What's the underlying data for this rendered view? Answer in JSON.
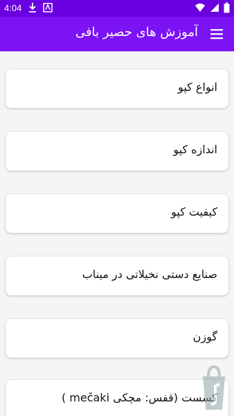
{
  "status_bar": {
    "time": "4:04",
    "left_icons": [
      "download-icon",
      "notification-icon"
    ],
    "right_icons": [
      "wifi-icon",
      "signal-icon",
      "battery-icon"
    ],
    "color": "#6a00e0"
  },
  "app_bar": {
    "title": "آموزش های حصیر بافی",
    "menu_icon": "hamburger-menu-icon",
    "color": "#7b13f5"
  },
  "menu": {
    "items": [
      {
        "label": "انواع کپو"
      },
      {
        "label": "اندازه کپو"
      },
      {
        "label": "کیفیت کپو"
      },
      {
        "label": "صنایع دستی نخیلاتی در میناب"
      },
      {
        "label": "گوزن"
      },
      {
        "label": "کسست (قفس: مچکی mečaki )"
      }
    ]
  },
  "watermark_icon": "cafebazaar-logo-icon"
}
